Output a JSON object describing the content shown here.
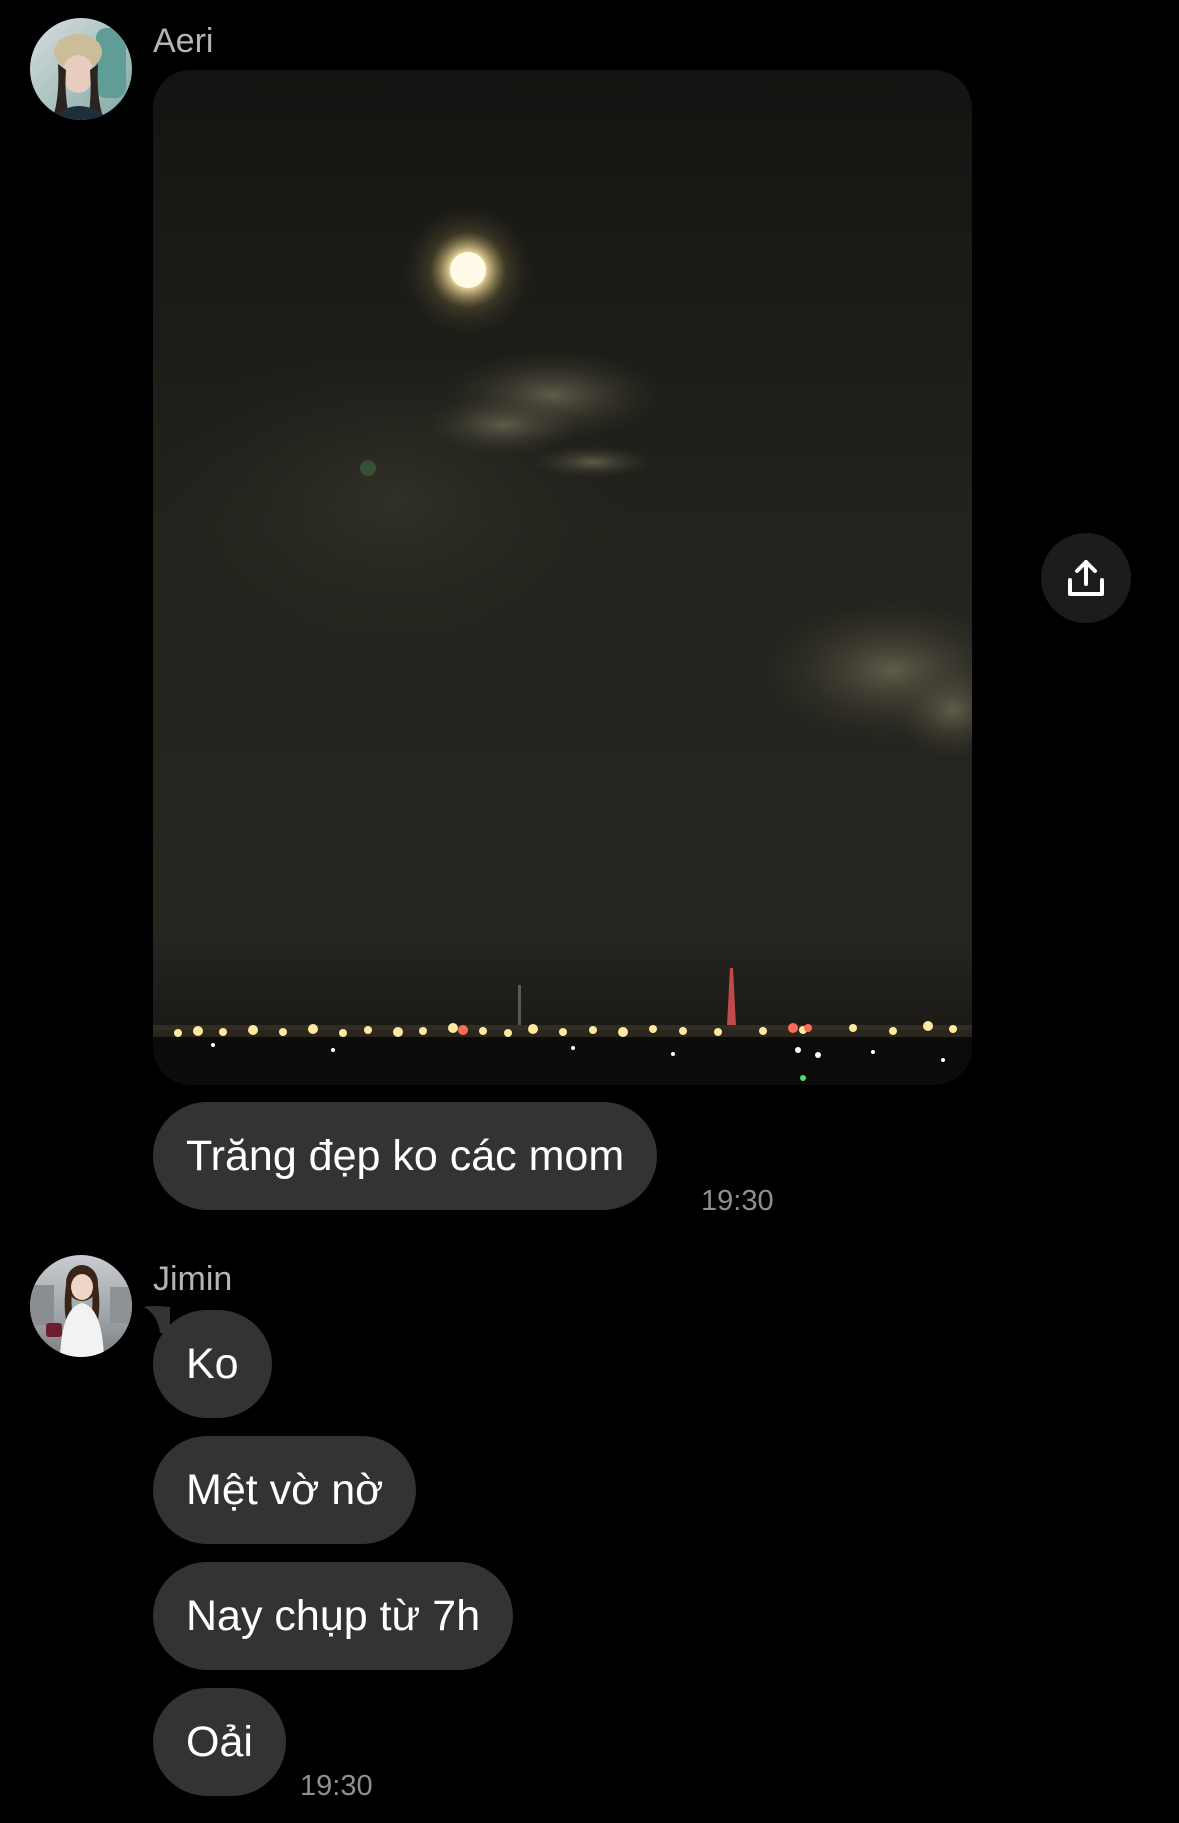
{
  "colors": {
    "background": "#000000",
    "bubble": "#333336",
    "sender_name": "#b4b4b8",
    "timestamp": "#8e8e93",
    "share_button_bg": "#1c1c1e"
  },
  "conversation": {
    "group1": {
      "sender": "Aeri",
      "photo": {
        "subject": "full moon over city lights at night"
      },
      "messages": [
        "Trăng đẹp ko các mom"
      ],
      "time": "19:30"
    },
    "group2": {
      "sender": "Jimin",
      "messages": [
        "Ko",
        "Mệt vờ nờ",
        "Nay chụp từ 7h",
        "Oải"
      ],
      "time": "19:30"
    }
  },
  "icons": {
    "share": "share-upload-icon"
  }
}
